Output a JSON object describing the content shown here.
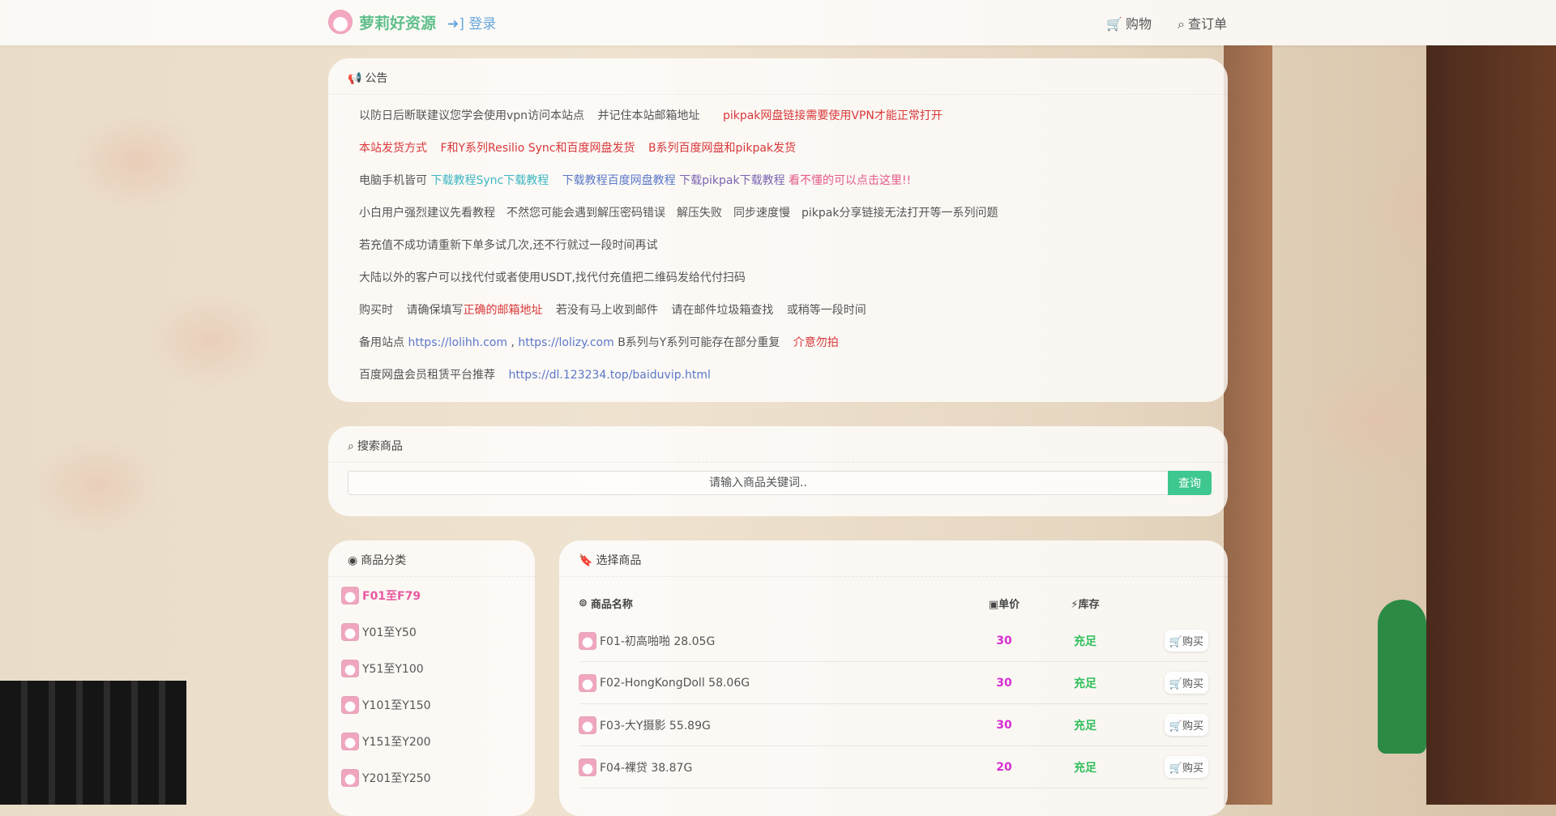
{
  "header": {
    "brand": "萝莉好资源",
    "login": "登录",
    "nav": [
      {
        "icon": "cart-icon",
        "label": "购物"
      },
      {
        "icon": "search-order-icon",
        "label": "查订单"
      }
    ]
  },
  "notice": {
    "title": "公告",
    "line1": {
      "a": "以防日后断联建议您学会使用vpn访问本站点",
      "b": "并记住本站邮箱地址",
      "c": "pikpak网盘链接需要使用VPN才能正常打开"
    },
    "line2": {
      "a": "本站发货方式",
      "b": "F和Y系列Resilio Sync和百度网盘发货",
      "c": "B系列百度网盘和pikpak发货"
    },
    "line3": {
      "a": "电脑手机皆可",
      "b": "下载教程Sync下载教程",
      "c": "下载教程百度网盘教程",
      "d": "下载pikpak下载教程",
      "e": "看不懂的可以点击这里!!"
    },
    "line4": "小白用户强烈建议先看教程　不然您可能会遇到解压密码错误　解压失败　同步速度慢　pikpak分享链接无法打开等一系列问题",
    "line5": "若充值不成功请重新下单多试几次,还不行就过一段时间再试",
    "line6": "大陆以外的客户可以找代付或者使用USDT,找代付充值把二维码发给代付扫码",
    "line7": {
      "a": "购买时",
      "b": "请确保填写",
      "c": "正确的邮箱地址",
      "d": "若没有马上收到邮件",
      "e": "请在邮件垃圾箱查找",
      "f": "或稍等一段时间"
    },
    "line8": {
      "a": "备用站点",
      "b": "https://lolihh.com",
      "c": ",",
      "d": "https://lolizy.com",
      "e": "B系列与Y系列可能存在部分重复",
      "f": "介意勿拍"
    },
    "line9": {
      "a": "百度网盘会员租赁平台推荐",
      "b": "https://dl.123234.top/baiduvip.html"
    }
  },
  "search": {
    "title": "搜索商品",
    "placeholder": "请输入商品关键词..",
    "button": "查询"
  },
  "categories": {
    "title": "商品分类",
    "items": [
      "F01至F79",
      "Y01至Y50",
      "Y51至Y100",
      "Y101至Y150",
      "Y151至Y200",
      "Y201至Y250"
    ]
  },
  "products": {
    "title": "选择商品",
    "headers": {
      "name": "商品名称",
      "price": "单价",
      "stock": "库存"
    },
    "buy_label": "购买",
    "rows": [
      {
        "name": "F01-初高啪啪 28.05G",
        "price": "30",
        "stock": "充足"
      },
      {
        "name": "F02-HongKongDoll 58.06G",
        "price": "30",
        "stock": "充足"
      },
      {
        "name": "F03-大Y摄影 55.89G",
        "price": "30",
        "stock": "充足"
      },
      {
        "name": "F04-裸贷 38.87G",
        "price": "20",
        "stock": "充足"
      }
    ]
  }
}
